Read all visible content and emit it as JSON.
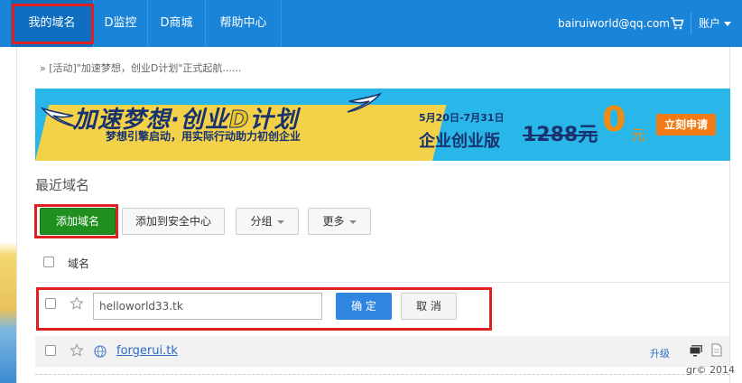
{
  "nav": {
    "items": [
      "我的域名",
      "D监控",
      "D商城",
      "帮助中心"
    ],
    "email": "bairuiworld@qq.com",
    "account": "账户"
  },
  "notice": "» [活动]\"加速梦想，创业D计划\"正式起航......",
  "banner": {
    "title_prefix": "加速梦想·创业",
    "title_mark": "D",
    "title_suffix": "计划",
    "subtitle": "梦想引擎启动，用实际行动助力初创企业",
    "date": "5月20日-7月31日",
    "edition": "企业创业版",
    "old_price": "1288元",
    "new_price": "0",
    "currency": "元",
    "apply": "立刻申请"
  },
  "section_title": "最近域名",
  "toolbar": {
    "add": "添加域名",
    "add_security": "添加到安全中心",
    "group": "分组",
    "more": "更多"
  },
  "table": {
    "col_domain": "域名"
  },
  "add_row": {
    "value": "helloworld33.tk",
    "confirm": "确 定",
    "cancel": "取 消"
  },
  "domain_row": {
    "name": "forgerui.tk",
    "upgrade": "升级"
  },
  "watermark": "gr© 2014",
  "colors": {
    "nav_bg": "#1a84d8",
    "add_button": "#1f8f1f",
    "confirm_button": "#2f86e0",
    "highlight": "#e02020"
  }
}
